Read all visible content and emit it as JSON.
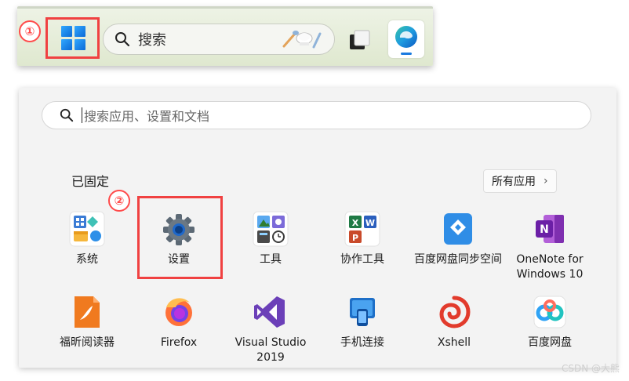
{
  "annotations": {
    "step1": "①",
    "step2": "②",
    "accent": "#f04141"
  },
  "taskbar": {
    "search_text": "搜索",
    "search_deco": "🥄🧑‍🍳🥄",
    "icons": [
      "start-icon",
      "search-icon",
      "task-view-icon",
      "edge-icon"
    ]
  },
  "start_menu": {
    "search_placeholder": "搜索应用、设置和文档",
    "pinned_title": "已固定",
    "all_apps_label": "所有应用",
    "all_apps_chevron": "›",
    "apps": [
      {
        "label": "系统",
        "icon": "system-icon"
      },
      {
        "label": "设置",
        "icon": "settings-gear-icon"
      },
      {
        "label": "工具",
        "icon": "tools-icon"
      },
      {
        "label": "协作工具",
        "icon": "office-collab-icon"
      },
      {
        "label": "百度网盘同步空间",
        "icon": "baidu-sync-icon"
      },
      {
        "label": "OneNote for Windows 10",
        "icon": "onenote-icon"
      },
      {
        "label": "福昕阅读器",
        "icon": "foxit-icon"
      },
      {
        "label": "Firefox",
        "icon": "firefox-icon"
      },
      {
        "label": "Visual Studio 2019",
        "icon": "visual-studio-icon"
      },
      {
        "label": "手机连接",
        "icon": "phone-link-icon"
      },
      {
        "label": "Xshell",
        "icon": "xshell-icon"
      },
      {
        "label": "百度网盘",
        "icon": "baidu-netdisk-icon"
      }
    ]
  },
  "watermark": "CSDN @大熊"
}
